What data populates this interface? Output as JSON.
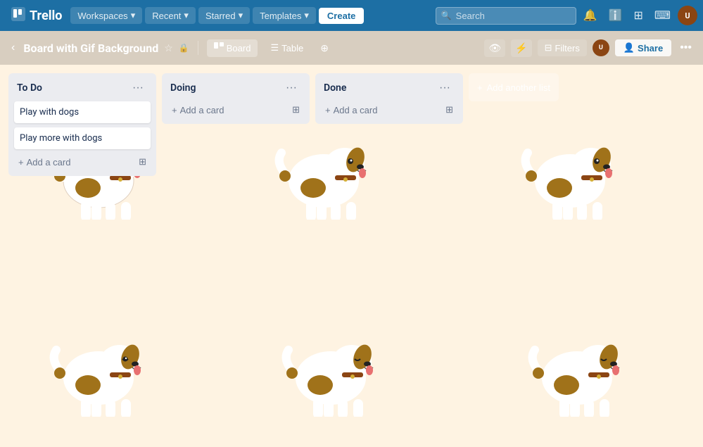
{
  "nav": {
    "logo": "Trello",
    "logo_icon": "⬛",
    "workspaces_label": "Workspaces",
    "recent_label": "Recent",
    "starred_label": "Starred",
    "templates_label": "Templates",
    "create_label": "Create",
    "search_placeholder": "Search",
    "notification_icon": "bell",
    "info_icon": "info",
    "apps_icon": "grid",
    "dev_icon": "code",
    "avatar_initials": "U"
  },
  "board_header": {
    "title": "Board with Gif Background",
    "collapse_icon": "chevron-left",
    "star_icon": "star",
    "lock_icon": "lock",
    "view_board_label": "Board",
    "view_table_label": "Table",
    "more_icon": "more",
    "power_icon": "lightning",
    "automation_icon": "automation",
    "filters_label": "Filters",
    "share_label": "Share",
    "ellipsis_icon": "ellipsis"
  },
  "lists": [
    {
      "id": "todo",
      "title": "To Do",
      "cards": [
        {
          "id": "card1",
          "text": "Play with dogs"
        },
        {
          "id": "card2",
          "text": "Play more with dogs"
        }
      ],
      "add_card_label": "Add a card"
    },
    {
      "id": "doing",
      "title": "Doing",
      "cards": [],
      "add_card_label": "Add a card"
    },
    {
      "id": "done",
      "title": "Done",
      "cards": [],
      "add_card_label": "Add a card"
    }
  ],
  "add_another_list_label": "Add another list",
  "colors": {
    "nav_bg": "#1d6fa4",
    "board_bg": "#fef3e2",
    "list_bg": "#ebecf0",
    "card_bg": "#ffffff"
  }
}
